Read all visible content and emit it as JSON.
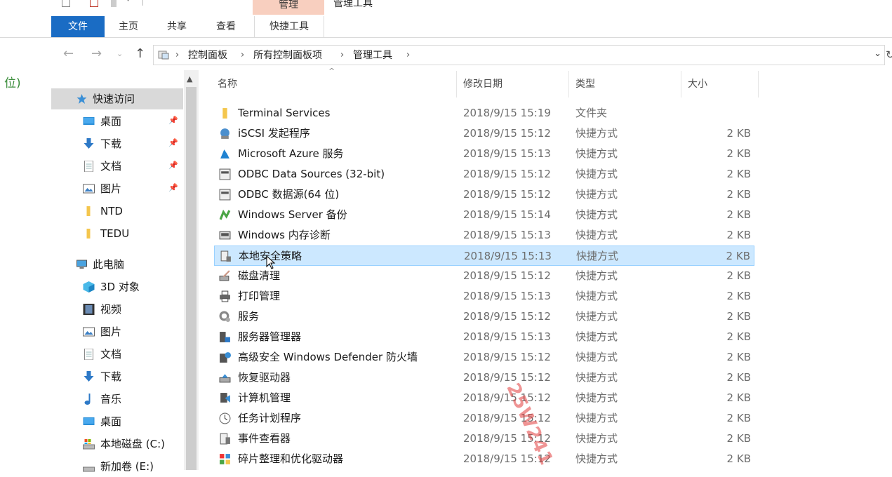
{
  "window": {
    "title": "管理工具",
    "context_tab_header": "管理"
  },
  "ribbon": {
    "tabs": [
      "文件",
      "主页",
      "共享",
      "查看",
      "快捷工具"
    ]
  },
  "address": {
    "breadcrumbs": [
      "控制面板",
      "所有控制面板项",
      "管理工具"
    ]
  },
  "partial_text": "位)",
  "sidebar": {
    "quick_access": "快速访问",
    "pinned": [
      {
        "label": "桌面",
        "icon": "desktop-icon"
      },
      {
        "label": "下载",
        "icon": "download-icon"
      },
      {
        "label": "文档",
        "icon": "document-icon"
      },
      {
        "label": "图片",
        "icon": "pictures-icon"
      }
    ],
    "folders": [
      {
        "label": "NTD",
        "icon": "folder-icon"
      },
      {
        "label": "TEDU",
        "icon": "folder-icon"
      }
    ],
    "this_pc": "此电脑",
    "pc_items": [
      {
        "label": "3D 对象",
        "icon": "3d-objects-icon"
      },
      {
        "label": "视频",
        "icon": "video-icon"
      },
      {
        "label": "图片",
        "icon": "pictures-icon"
      },
      {
        "label": "文档",
        "icon": "document-icon"
      },
      {
        "label": "下载",
        "icon": "download-icon"
      },
      {
        "label": "音乐",
        "icon": "music-icon"
      },
      {
        "label": "桌面",
        "icon": "desktop-icon"
      },
      {
        "label": "本地磁盘 (C:)",
        "icon": "drive-icon"
      },
      {
        "label": "新加卷 (E:)",
        "icon": "drive-icon"
      }
    ]
  },
  "columns": {
    "name": "名称",
    "date": "修改日期",
    "type": "类型",
    "size": "大小"
  },
  "files": [
    {
      "name": "Terminal Services",
      "date": "2018/9/15 15:19",
      "type": "文件夹",
      "size": "",
      "icon": "folder-icon"
    },
    {
      "name": "iSCSI 发起程序",
      "date": "2018/9/15 15:12",
      "type": "快捷方式",
      "size": "2 KB",
      "icon": "iscsi-icon"
    },
    {
      "name": "Microsoft Azure 服务",
      "date": "2018/9/15 15:13",
      "type": "快捷方式",
      "size": "2 KB",
      "icon": "azure-icon"
    },
    {
      "name": "ODBC Data Sources (32-bit)",
      "date": "2018/9/15 15:12",
      "type": "快捷方式",
      "size": "2 KB",
      "icon": "odbc-icon"
    },
    {
      "name": "ODBC 数据源(64 位)",
      "date": "2018/9/15 15:12",
      "type": "快捷方式",
      "size": "2 KB",
      "icon": "odbc-icon"
    },
    {
      "name": "Windows Server 备份",
      "date": "2018/9/15 15:14",
      "type": "快捷方式",
      "size": "2 KB",
      "icon": "backup-icon"
    },
    {
      "name": "Windows 内存诊断",
      "date": "2018/9/15 15:13",
      "type": "快捷方式",
      "size": "2 KB",
      "icon": "memory-icon"
    },
    {
      "name": "本地安全策略",
      "date": "2018/9/15 15:13",
      "type": "快捷方式",
      "size": "2 KB",
      "icon": "security-policy-icon",
      "selected": true
    },
    {
      "name": "磁盘清理",
      "date": "2018/9/15 15:12",
      "type": "快捷方式",
      "size": "2 KB",
      "icon": "disk-cleanup-icon"
    },
    {
      "name": "打印管理",
      "date": "2018/9/15 15:13",
      "type": "快捷方式",
      "size": "2 KB",
      "icon": "print-icon"
    },
    {
      "name": "服务",
      "date": "2018/9/15 15:12",
      "type": "快捷方式",
      "size": "2 KB",
      "icon": "services-icon"
    },
    {
      "name": "服务器管理器",
      "date": "2018/9/15 15:13",
      "type": "快捷方式",
      "size": "2 KB",
      "icon": "server-manager-icon"
    },
    {
      "name": "高级安全 Windows Defender 防火墙",
      "date": "2018/9/15 15:12",
      "type": "快捷方式",
      "size": "2 KB",
      "icon": "firewall-icon"
    },
    {
      "name": "恢复驱动器",
      "date": "2018/9/15 15:12",
      "type": "快捷方式",
      "size": "2 KB",
      "icon": "recovery-icon"
    },
    {
      "name": "计算机管理",
      "date": "2018/9/15 15:12",
      "type": "快捷方式",
      "size": "2 KB",
      "icon": "computer-management-icon"
    },
    {
      "name": "任务计划程序",
      "date": "2018/9/15 15:12",
      "type": "快捷方式",
      "size": "2 KB",
      "icon": "task-scheduler-icon"
    },
    {
      "name": "事件查看器",
      "date": "2018/9/15 15:12",
      "type": "快捷方式",
      "size": "2 KB",
      "icon": "event-viewer-icon"
    },
    {
      "name": "碎片整理和优化驱动器",
      "date": "2018/9/15 15:12",
      "type": "快捷方式",
      "size": "2 KB",
      "icon": "defrag-icon"
    }
  ],
  "watermark": "25W241"
}
